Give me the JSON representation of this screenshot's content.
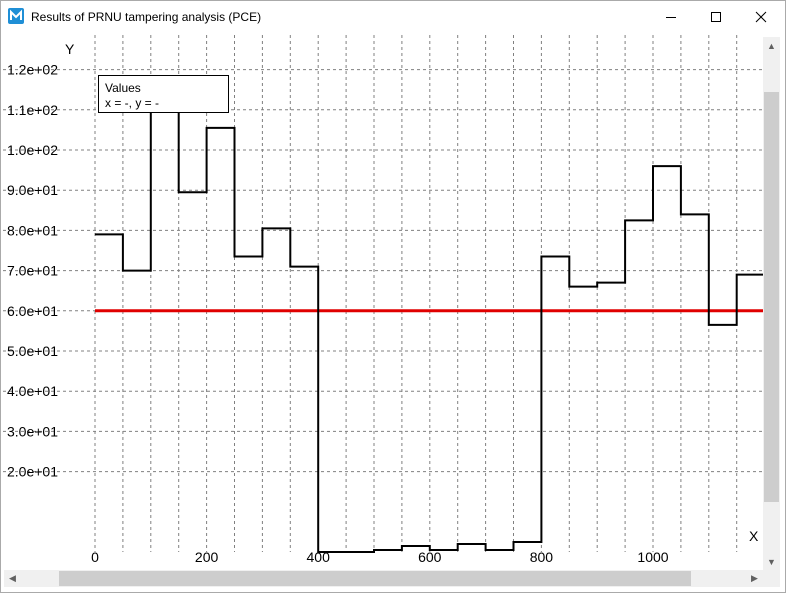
{
  "window": {
    "title": "Results of PRNU tampering analysis (PCE)",
    "icon": "app-logo-icon",
    "controls": [
      "minimize-icon",
      "maximize-icon",
      "close-icon"
    ]
  },
  "values_box": {
    "title": "Values",
    "text": "x = -, y = -"
  },
  "chart_data": {
    "type": "line",
    "step": true,
    "xlabel": "X",
    "ylabel": "Y",
    "x_tick_labels": [
      "0",
      "200",
      "400",
      "600",
      "800",
      "1000"
    ],
    "y_tick_labels": [
      "2.0e+01",
      "3.0e+01",
      "4.0e+01",
      "5.0e+01",
      "6.0e+01",
      "7.0e+01",
      "8.0e+01",
      "9.0e+01",
      "1.0e+02",
      "1.1e+02",
      "1.2e+02"
    ],
    "xlim": [
      -20,
      1200
    ],
    "ylim": [
      0,
      124
    ],
    "grid": true,
    "bin_edges": [
      0,
      50,
      100,
      150,
      200,
      250,
      300,
      350,
      400,
      450,
      500,
      550,
      600,
      650,
      700,
      750,
      800,
      850,
      900,
      950,
      1000,
      1050,
      1100,
      1150,
      1200
    ],
    "series": [
      {
        "color": "#000000",
        "values": [
          79,
          70,
          112,
          89.5,
          105.5,
          73.5,
          80.5,
          71,
          0,
          0,
          0.5,
          1.5,
          0.5,
          2,
          0.5,
          2.5,
          73.5,
          66,
          67,
          82.5,
          96,
          84,
          56.5,
          69
        ]
      },
      {
        "color": "#e00000",
        "values": [
          60,
          60
        ]
      }
    ]
  },
  "colors": {
    "grid": "#808080",
    "threshold": "#e00000",
    "scroll_thumb": "#cdcdcd"
  }
}
